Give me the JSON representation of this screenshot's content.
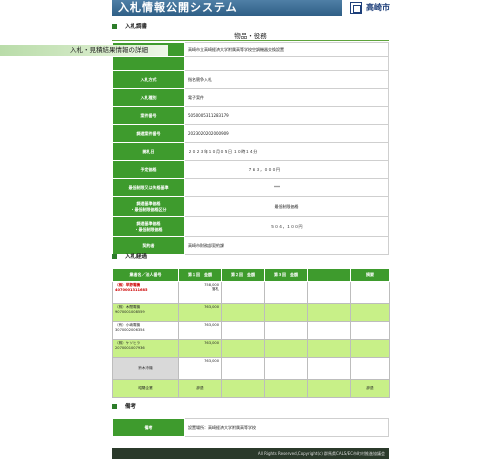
{
  "header": {
    "system_title": "入札情報公開システム",
    "city_name": "高崎市"
  },
  "info_section": {
    "heading": "入札調書",
    "category": "物品・役務",
    "page_heading": "入札・見積結果情報の詳細",
    "rows": [
      {
        "label": "",
        "value": "高崎市立高崎経済大学附属高等学校空調機器交換設置"
      },
      {
        "label": "入札方式",
        "value": "指名競争入札"
      },
      {
        "label": "入札種別",
        "value": "電子案件"
      },
      {
        "label": "案件番号",
        "value": "5050005311283179"
      },
      {
        "label": "調達案件番号",
        "value": "2023020202000909"
      },
      {
        "label": "開札日",
        "value": "２０２３年１０月０５日 １０時１４分"
      },
      {
        "label": "予定価格",
        "value": "７６３，０００円"
      },
      {
        "label": "最低制限又は失格基準",
        "value": "***"
      },
      {
        "label": "調達基準価格\n・最低制限価格区分",
        "value": "最低制限価格"
      },
      {
        "label": "調達基準価格\n・最低制限価格",
        "value": "５０４，１００円"
      },
      {
        "label": "契約者",
        "value": "高崎市財務部契約課"
      }
    ]
  },
  "bids_section": {
    "heading": "入札経過",
    "columns": [
      "業者名／法人番号",
      "第１回　金額",
      "第２回　金額",
      "第３回　金額",
      "",
      "摘要"
    ],
    "rows": [
      {
        "name": "（株）早野電機",
        "id": "4070001311685",
        "amount": "758,000",
        "note": "落札",
        "remark": "",
        "style": "w",
        "winner": true
      },
      {
        "name": "（株）木間電機",
        "id": "9070001008559",
        "amount": "763,000",
        "note": "",
        "remark": "",
        "style": "g",
        "winner": false
      },
      {
        "name": "（有）小嶋電機",
        "id": "3070002006354",
        "amount": "763,000",
        "note": "",
        "remark": "",
        "style": "w",
        "winner": false
      },
      {
        "name": "（株）ケソヒラ",
        "id": "2070001007936",
        "amount": "763,000",
        "note": "",
        "remark": "",
        "style": "g",
        "winner": false
      },
      {
        "name": "鈴木冷機",
        "id": "",
        "amount": "763,000",
        "note": "",
        "remark": "",
        "style": "gray",
        "winner": false
      },
      {
        "name": "昭陽企業",
        "id": "",
        "amount": "辞退",
        "note": "",
        "remark": "辞退",
        "style": "g",
        "winner": false
      }
    ]
  },
  "remarks_section": {
    "heading": "備考",
    "label": "備考",
    "value": "設置場所：高崎経済大学附属高等学校"
  },
  "footer": {
    "text": "All Rights Reserved,Copyright(c) 群馬県CALS/EC市町村推進協議会"
  },
  "colors": {
    "banner": "#2f5f86",
    "header_green": "#3e9b2d",
    "row_green": "#c8f088",
    "winner_red": "#cc0000"
  }
}
